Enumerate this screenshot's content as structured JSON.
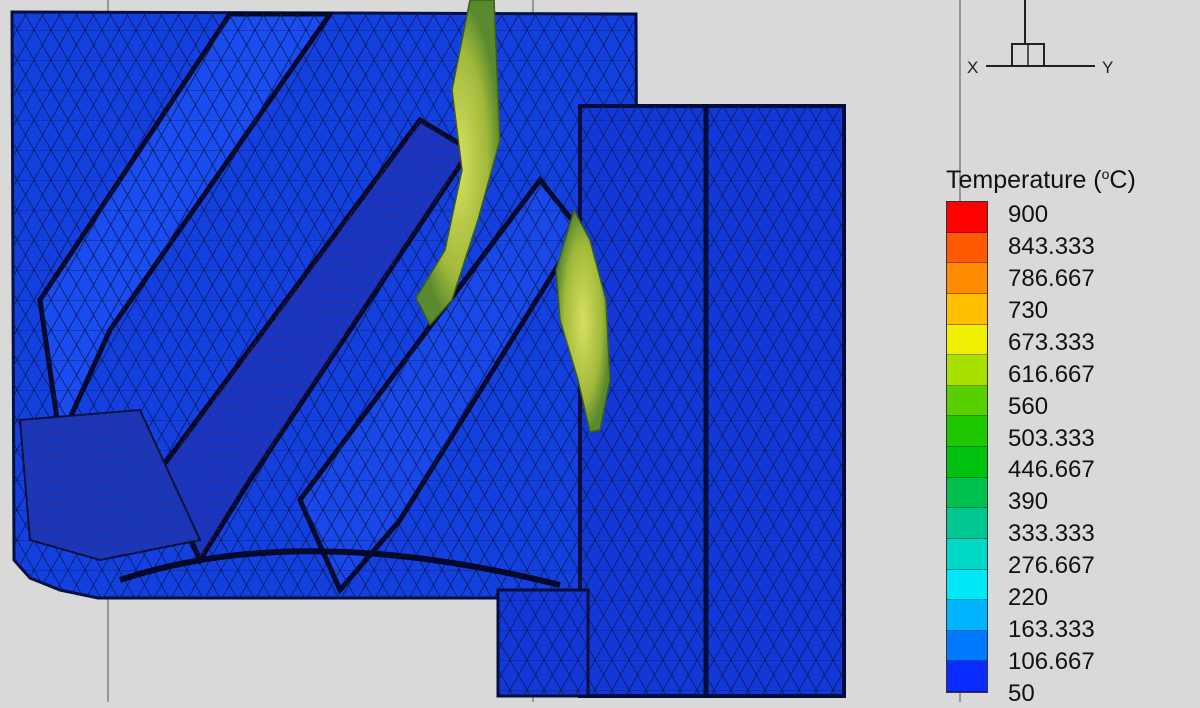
{
  "legend": {
    "title": "Temperature (",
    "title_sup": "o",
    "title_suffix": "C)",
    "values": [
      "900",
      "843.333",
      "786.667",
      "730",
      "673.333",
      "616.667",
      "560",
      "503.333",
      "446.667",
      "390",
      "333.333",
      "276.667",
      "220",
      "163.333",
      "106.667",
      "50"
    ],
    "colors": [
      "#ff0000",
      "#ff5a00",
      "#ff8c00",
      "#ffbe00",
      "#f0f000",
      "#a8e000",
      "#58d000",
      "#1ec800",
      "#00c010",
      "#00c050",
      "#00c890",
      "#00d8c8",
      "#00e8f8",
      "#00b4ff",
      "#0078ff",
      "#0a2bff"
    ]
  },
  "axes": {
    "x_label": "X",
    "y_label": "Y"
  },
  "mesh": {
    "base_color": "#1238d8",
    "hot_color": "#b8c83c"
  }
}
